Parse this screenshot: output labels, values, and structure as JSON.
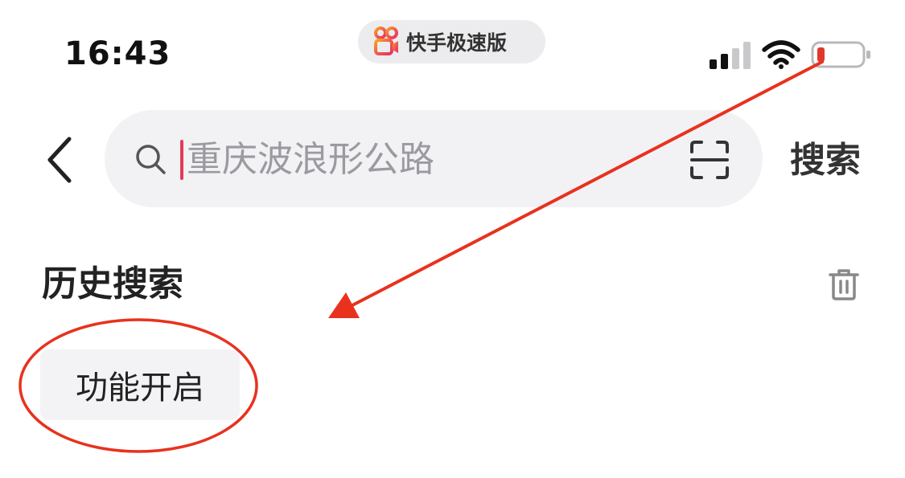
{
  "status_bar": {
    "time": "16:43",
    "app_name": "快手极速版",
    "signal_icon": "cellular-signal-icon",
    "wifi_icon": "wifi-icon",
    "battery_icon": "battery-low-icon",
    "battery_color": "#e0372c"
  },
  "search": {
    "back_icon": "chevron-left-icon",
    "placeholder": "重庆波浪形公路",
    "value": "",
    "search_icon": "search-icon",
    "scan_icon": "scan-icon",
    "action_label": "搜索",
    "caret_color": "#e23b5a"
  },
  "history": {
    "title": "历史搜索",
    "clear_icon": "trash-icon",
    "items": [
      {
        "label": "功能开启"
      }
    ]
  },
  "annotation": {
    "color": "#e8321e",
    "arrow": "arrow-from-battery-to-history",
    "circle": "circle-around-history-item"
  },
  "colors": {
    "background": "#ffffff",
    "search_bg": "#f2f2f5",
    "chip_bg": "#f3f3f6",
    "pill_bg": "#ececee",
    "text": "#222222",
    "muted": "#9a9aa0"
  }
}
